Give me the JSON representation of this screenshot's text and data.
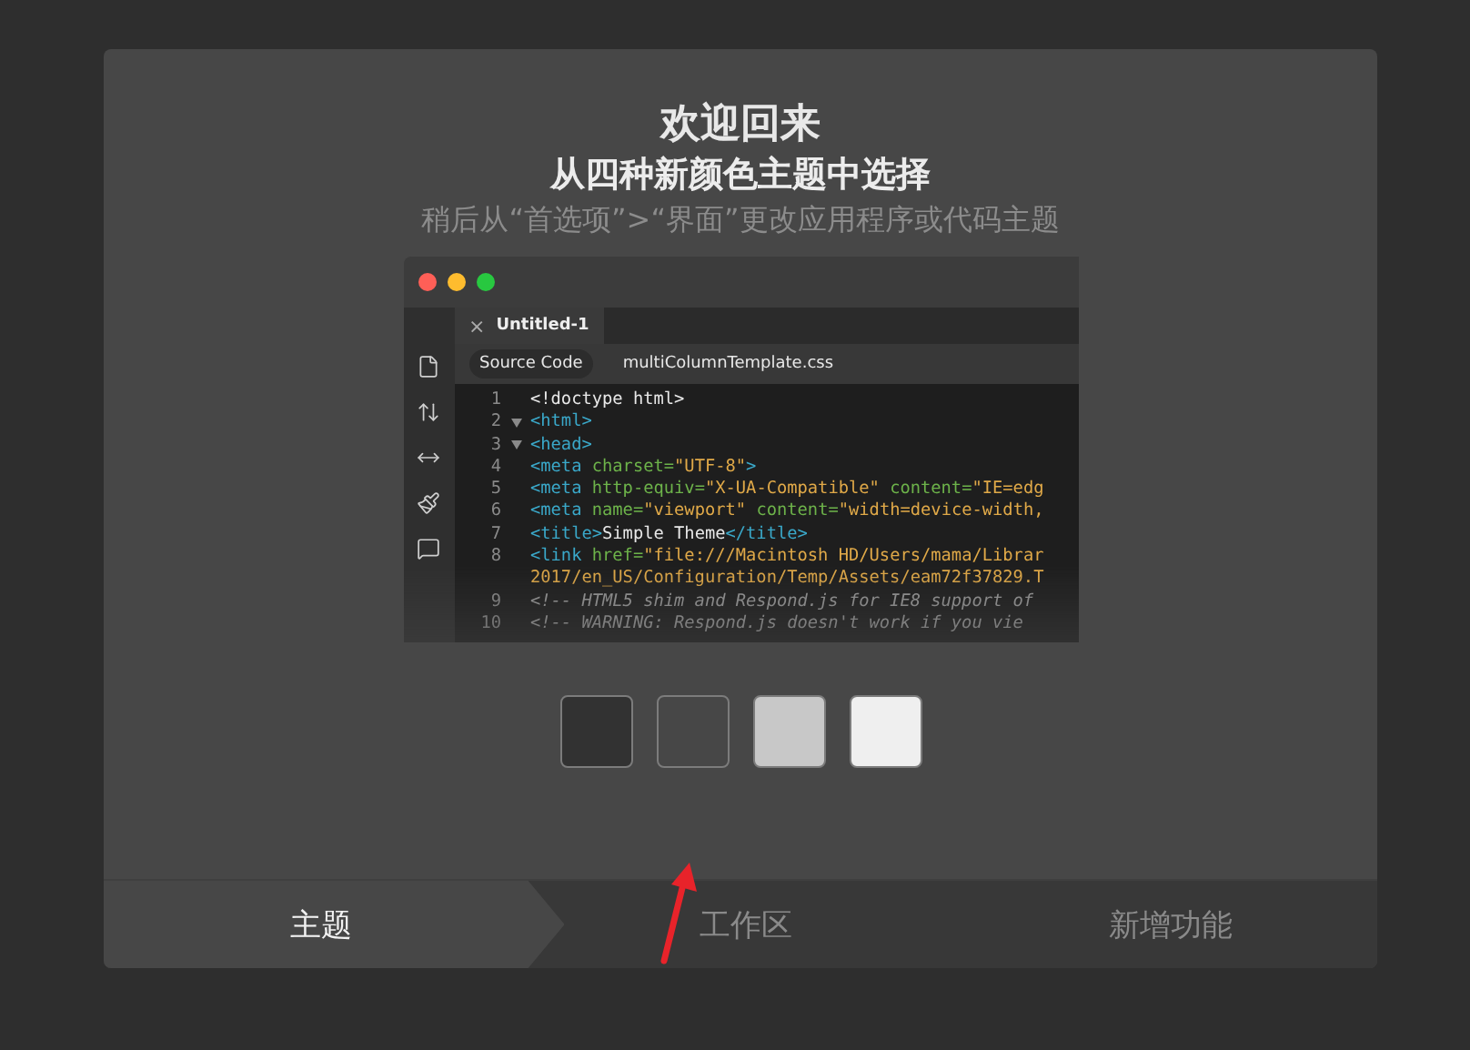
{
  "dialog": {
    "title": "欢迎回来",
    "subtitle": "从四种新颜色主题中选择",
    "hint": "稍后从“首选项”>“界面”更改应用程序或代码主题"
  },
  "preview": {
    "tab": "Untitled-1",
    "tab_close": "×",
    "related_files": [
      {
        "label": "Source Code",
        "selected": true
      },
      {
        "label": "multiColumnTemplate.css",
        "selected": false
      }
    ],
    "lines": [
      {
        "num": "1",
        "fold": false,
        "segments": [
          {
            "kind": "text",
            "text": "<!doctype html>"
          }
        ]
      },
      {
        "num": "2",
        "fold": true,
        "segments": [
          {
            "kind": "tag",
            "text": "<html>"
          }
        ]
      },
      {
        "num": "3",
        "fold": true,
        "segments": [
          {
            "kind": "tag",
            "text": "<head>"
          }
        ]
      },
      {
        "num": "4",
        "fold": false,
        "segments": [
          {
            "kind": "tag",
            "text": "<meta "
          },
          {
            "kind": "attr",
            "text": "charset="
          },
          {
            "kind": "str",
            "text": "\"UTF-8\""
          },
          {
            "kind": "tag",
            "text": ">"
          }
        ]
      },
      {
        "num": "5",
        "fold": false,
        "segments": [
          {
            "kind": "tag",
            "text": "<meta "
          },
          {
            "kind": "attr",
            "text": "http-equiv="
          },
          {
            "kind": "str",
            "text": "\"X-UA-Compatible\""
          },
          {
            "kind": "attr",
            "text": " content="
          },
          {
            "kind": "str",
            "text": "\"IE=edg"
          }
        ]
      },
      {
        "num": "6",
        "fold": false,
        "segments": [
          {
            "kind": "tag",
            "text": "<meta "
          },
          {
            "kind": "attr",
            "text": "name="
          },
          {
            "kind": "str",
            "text": "\"viewport\""
          },
          {
            "kind": "attr",
            "text": " content="
          },
          {
            "kind": "str",
            "text": "\"width=device-width,"
          }
        ]
      },
      {
        "num": "7",
        "fold": false,
        "segments": [
          {
            "kind": "tag",
            "text": "<title>"
          },
          {
            "kind": "text",
            "text": "Simple Theme"
          },
          {
            "kind": "tag",
            "text": "</title>"
          }
        ]
      },
      {
        "num": "8",
        "fold": false,
        "segments": [
          {
            "kind": "tag",
            "text": "<link "
          },
          {
            "kind": "attr",
            "text": "href="
          },
          {
            "kind": "str",
            "text": "\"file:///Macintosh HD/Users/mama/Librar"
          }
        ]
      },
      {
        "fold": false,
        "segments": [
          {
            "kind": "str",
            "text": "2017/en_US/Configuration/Temp/Assets/eam72f37829.T"
          }
        ]
      },
      {
        "num": "9",
        "fold": false,
        "segments": [
          {
            "kind": "comment",
            "text": "<!-- HTML5 shim and Respond.js for IE8 support of"
          }
        ]
      },
      {
        "num": "10",
        "fold": false,
        "segments": [
          {
            "kind": "comment",
            "text": "<!-- WARNING: Respond.js doesn't work if you vie"
          }
        ]
      }
    ]
  },
  "swatches": [
    {
      "color": "#323232"
    },
    {
      "color": "#474747"
    },
    {
      "color": "#c8c8c8"
    },
    {
      "color": "#efefef"
    }
  ],
  "steps": [
    {
      "label": "主题",
      "selected": true
    },
    {
      "label": "工作区",
      "selected": false
    },
    {
      "label": "新增功能",
      "selected": false
    }
  ]
}
